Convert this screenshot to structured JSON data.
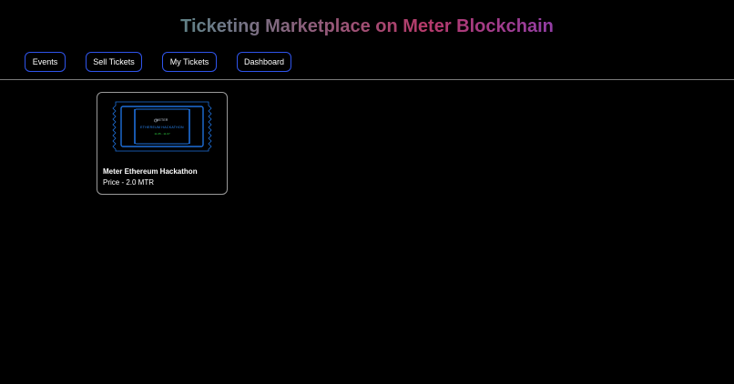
{
  "header": {
    "title": "Ticketing Marketplace on Meter Blockchain"
  },
  "nav": {
    "items": [
      {
        "label": "Events"
      },
      {
        "label": "Sell Tickets"
      },
      {
        "label": "My Tickets"
      },
      {
        "label": "Dashboard"
      }
    ]
  },
  "events": [
    {
      "name": "Meter Ethereum Hackathon",
      "price": "Price - 2.0 MTR",
      "ticket_image": {
        "brand": "METER",
        "event": "ETHEREUM HACKATHON",
        "date": "11.05 - 11.07"
      }
    }
  ],
  "colors": {
    "background": "#000000",
    "button_border": "#2f54eb",
    "ticket_outline": "#1e6fd9",
    "title_gradient": [
      "#1fa37a",
      "#6e7a88",
      "#b63a6a",
      "#8a3fb6",
      "#5a3fd0"
    ]
  }
}
